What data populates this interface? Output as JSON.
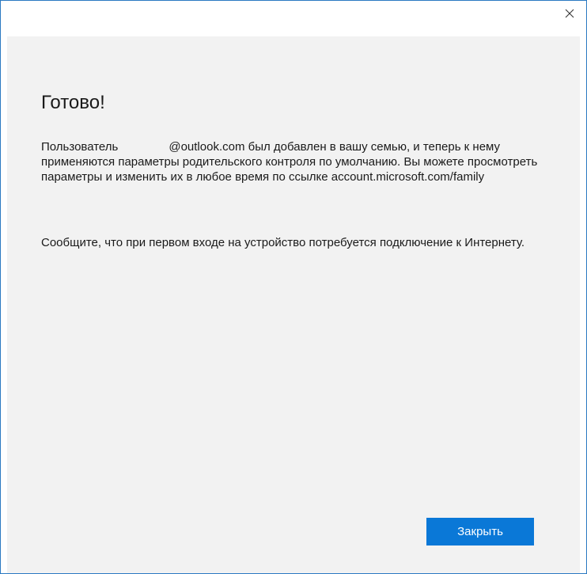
{
  "dialog": {
    "close_icon": "close-icon",
    "title": "Готово!",
    "message1": {
      "prefix": "Пользователь",
      "email": "@outlook.com",
      "rest": "был добавлен в вашу семью, и теперь к нему применяются параметры родительского контроля по умолчанию. Вы можете просмотреть параметры и изменить их в любое время по ссылке account.microsoft.com/family"
    },
    "message2": "Сообщите, что при первом входе на устройство потребуется подключение к Интернету.",
    "close_button_label": "Закрыть"
  },
  "colors": {
    "accent": "#0a78d7",
    "border": "#2b79c2",
    "panel_background": "#f2f2f2"
  }
}
